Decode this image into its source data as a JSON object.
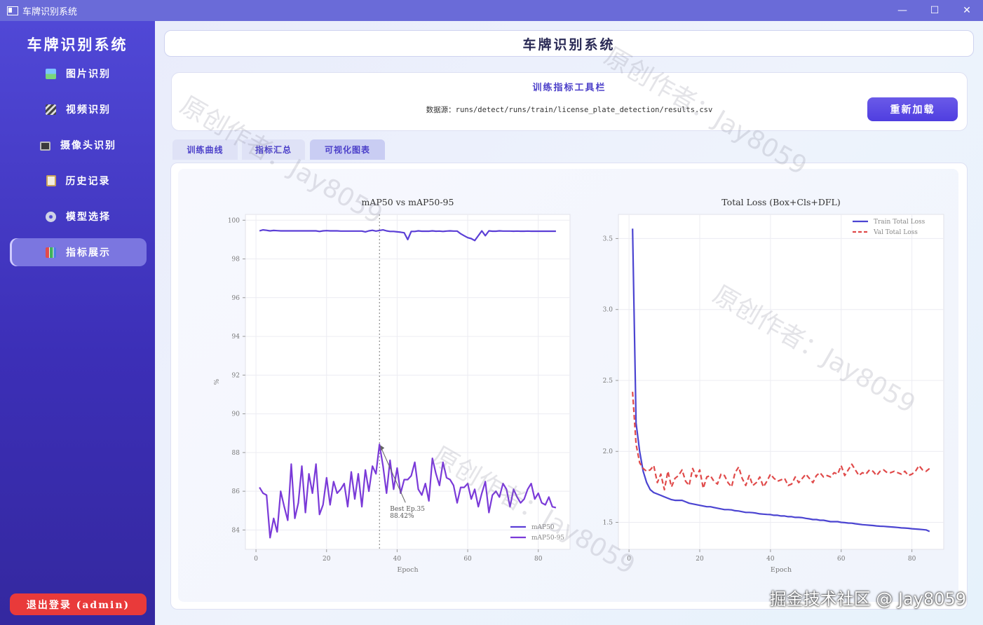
{
  "window": {
    "title": "车牌识别系统",
    "minimize": "—",
    "maximize": "☐",
    "close": "✕"
  },
  "sidebar": {
    "brand": "车牌识别系统",
    "items": [
      {
        "label": "图片识别",
        "icon": "picture-icon"
      },
      {
        "label": "视频识别",
        "icon": "clapper-icon"
      },
      {
        "label": "摄像头识别",
        "icon": "camera-icon"
      },
      {
        "label": "历史记录",
        "icon": "clipboard-icon"
      },
      {
        "label": "模型选择",
        "icon": "gear-icon"
      },
      {
        "label": "指标展示",
        "icon": "bar-chart-icon",
        "active": true
      }
    ],
    "logout": "退出登录 (admin)"
  },
  "header": {
    "title": "车牌识别系统"
  },
  "toolbar": {
    "title": "训练指标工具栏",
    "source_label": "数据源：",
    "source_path": "runs/detect/runs/train/license_plate_detection/results.csv",
    "reload": "重新加载"
  },
  "tabs": [
    {
      "label": "训练曲线"
    },
    {
      "label": "指标汇总"
    },
    {
      "label": "可视化图表",
      "active": true
    }
  ],
  "watermarks": {
    "author": "原创作者：Jay8059",
    "footer": "掘金技术社区 @ Jay8059"
  },
  "colors": {
    "accent": "#4f3ee0",
    "map50": "#5b3fd6",
    "map5095": "#7a3ad8",
    "train_loss": "#4b44d1",
    "val_loss": "#e04a4a",
    "logout": "#e93a3a"
  },
  "chart_data": [
    {
      "type": "line",
      "title": "mAP50 vs mAP50-95",
      "xlabel": "Epoch",
      "ylabel": "%",
      "xlim": [
        -3,
        89
      ],
      "ylim": [
        83,
        100.3
      ],
      "xticks": [
        0,
        20,
        40,
        60,
        80
      ],
      "yticks": [
        84,
        86,
        88,
        90,
        92,
        94,
        96,
        98,
        100
      ],
      "legend": "bottom-right",
      "grid": true,
      "annotation": {
        "x": 35,
        "y": 88.42,
        "text_line1": "Best Ep.35",
        "text_line2": "88.42%"
      },
      "best_epoch_line": 35,
      "series": [
        {
          "name": "mAP50",
          "x": [
            1,
            2,
            3,
            4,
            5,
            6,
            7,
            8,
            9,
            10,
            11,
            12,
            13,
            14,
            15,
            16,
            17,
            18,
            19,
            20,
            21,
            22,
            23,
            24,
            25,
            26,
            27,
            28,
            29,
            30,
            31,
            32,
            33,
            34,
            35,
            36,
            37,
            38,
            39,
            40,
            41,
            42,
            43,
            44,
            45,
            46,
            47,
            48,
            49,
            50,
            51,
            52,
            53,
            54,
            55,
            56,
            57,
            58,
            59,
            60,
            61,
            62,
            63,
            64,
            65,
            66,
            67,
            68,
            69,
            70,
            71,
            72,
            73,
            74,
            75,
            76,
            77,
            78,
            79,
            80,
            81,
            82,
            83,
            84,
            85
          ],
          "y": [
            99.45,
            99.5,
            99.48,
            99.45,
            99.47,
            99.46,
            99.45,
            99.45,
            99.45,
            99.45,
            99.45,
            99.45,
            99.45,
            99.45,
            99.45,
            99.45,
            99.45,
            99.42,
            99.45,
            99.46,
            99.45,
            99.45,
            99.45,
            99.44,
            99.44,
            99.44,
            99.44,
            99.44,
            99.44,
            99.44,
            99.4,
            99.45,
            99.48,
            99.44,
            99.47,
            99.5,
            99.45,
            99.42,
            99.42,
            99.4,
            99.38,
            99.35,
            99.0,
            99.42,
            99.42,
            99.45,
            99.43,
            99.43,
            99.43,
            99.45,
            99.43,
            99.44,
            99.42,
            99.44,
            99.45,
            99.44,
            99.44,
            99.3,
            99.2,
            99.1,
            99.05,
            98.95,
            99.2,
            99.45,
            99.2,
            99.45,
            99.43,
            99.43,
            99.45,
            99.44,
            99.44,
            99.44,
            99.43,
            99.44,
            99.43,
            99.43,
            99.44,
            99.43,
            99.43,
            99.43,
            99.43,
            99.43,
            99.43,
            99.43,
            99.43
          ]
        },
        {
          "name": "mAP50-95",
          "x": [
            1,
            2,
            3,
            4,
            5,
            6,
            7,
            8,
            9,
            10,
            11,
            12,
            13,
            14,
            15,
            16,
            17,
            18,
            19,
            20,
            21,
            22,
            23,
            24,
            25,
            26,
            27,
            28,
            29,
            30,
            31,
            32,
            33,
            34,
            35,
            36,
            37,
            38,
            39,
            40,
            41,
            42,
            43,
            44,
            45,
            46,
            47,
            48,
            49,
            50,
            51,
            52,
            53,
            54,
            55,
            56,
            57,
            58,
            59,
            60,
            61,
            62,
            63,
            64,
            65,
            66,
            67,
            68,
            69,
            70,
            71,
            72,
            73,
            74,
            75,
            76,
            77,
            78,
            79,
            80,
            81,
            82,
            83,
            84,
            85
          ],
          "y": [
            86.2,
            85.9,
            85.8,
            83.6,
            84.6,
            83.9,
            86.0,
            85.2,
            84.5,
            87.4,
            84.6,
            85.4,
            87.3,
            84.9,
            86.9,
            85.9,
            87.4,
            84.8,
            85.3,
            86.7,
            85.3,
            86.5,
            85.9,
            86.1,
            86.4,
            85.2,
            87.0,
            85.6,
            86.9,
            85.2,
            87.1,
            86.0,
            87.3,
            86.9,
            88.42,
            87.3,
            85.9,
            87.6,
            86.1,
            87.2,
            85.9,
            86.6,
            86.6,
            86.8,
            87.5,
            86.1,
            85.8,
            86.4,
            85.5,
            87.7,
            86.9,
            86.3,
            87.5,
            86.7,
            86.6,
            86.3,
            85.4,
            86.2,
            86.2,
            86.4,
            85.6,
            86.1,
            85.2,
            85.9,
            86.5,
            84.9,
            85.8,
            86.0,
            85.7,
            86.4,
            86.1,
            85.2,
            86.1,
            85.7,
            85.4,
            85.6,
            86.1,
            86.4,
            85.6,
            85.9,
            85.4,
            85.3,
            85.7,
            85.2,
            85.15
          ]
        }
      ]
    },
    {
      "type": "line",
      "title": "Total Loss (Box+Cls+DFL)",
      "xlabel": "Epoch",
      "ylabel": "",
      "xlim": [
        -3,
        89
      ],
      "ylim": [
        1.31,
        3.67
      ],
      "xticks": [
        0,
        20,
        40,
        60,
        80
      ],
      "yticks": [
        1.5,
        2.0,
        2.5,
        3.0,
        3.5
      ],
      "legend": "top-right",
      "grid": true,
      "series": [
        {
          "name": "Train Total Loss",
          "x": [
            1,
            2,
            3,
            4,
            5,
            6,
            7,
            8,
            9,
            10,
            11,
            12,
            13,
            14,
            15,
            16,
            17,
            18,
            19,
            20,
            21,
            22,
            23,
            24,
            25,
            26,
            27,
            28,
            29,
            30,
            31,
            32,
            33,
            34,
            35,
            36,
            37,
            38,
            39,
            40,
            41,
            42,
            43,
            44,
            45,
            46,
            47,
            48,
            49,
            50,
            51,
            52,
            53,
            54,
            55,
            56,
            57,
            58,
            59,
            60,
            61,
            62,
            63,
            64,
            65,
            66,
            67,
            68,
            69,
            70,
            71,
            72,
            73,
            74,
            75,
            76,
            77,
            78,
            79,
            80,
            81,
            82,
            83,
            84,
            85
          ],
          "y": [
            3.57,
            2.2,
            2.0,
            1.86,
            1.78,
            1.73,
            1.71,
            1.7,
            1.69,
            1.68,
            1.67,
            1.66,
            1.655,
            1.655,
            1.655,
            1.645,
            1.635,
            1.63,
            1.625,
            1.62,
            1.615,
            1.61,
            1.61,
            1.605,
            1.6,
            1.595,
            1.59,
            1.59,
            1.588,
            1.582,
            1.58,
            1.575,
            1.57,
            1.57,
            1.568,
            1.565,
            1.56,
            1.558,
            1.556,
            1.555,
            1.55,
            1.55,
            1.545,
            1.545,
            1.54,
            1.54,
            1.535,
            1.535,
            1.533,
            1.528,
            1.525,
            1.52,
            1.52,
            1.515,
            1.515,
            1.51,
            1.505,
            1.505,
            1.505,
            1.5,
            1.498,
            1.495,
            1.494,
            1.49,
            1.487,
            1.484,
            1.482,
            1.48,
            1.478,
            1.475,
            1.473,
            1.472,
            1.47,
            1.468,
            1.466,
            1.464,
            1.461,
            1.46,
            1.458,
            1.455,
            1.453,
            1.451,
            1.449,
            1.447,
            1.436
          ]
        },
        {
          "name": "Val Total Loss",
          "x": [
            1,
            2,
            3,
            4,
            5,
            6,
            7,
            8,
            9,
            10,
            11,
            12,
            13,
            14,
            15,
            16,
            17,
            18,
            19,
            20,
            21,
            22,
            23,
            24,
            25,
            26,
            27,
            28,
            29,
            30,
            31,
            32,
            33,
            34,
            35,
            36,
            37,
            38,
            39,
            40,
            41,
            42,
            43,
            44,
            45,
            46,
            47,
            48,
            49,
            50,
            51,
            52,
            53,
            54,
            55,
            56,
            57,
            58,
            59,
            60,
            61,
            62,
            63,
            64,
            65,
            66,
            67,
            68,
            69,
            70,
            71,
            72,
            73,
            74,
            75,
            76,
            77,
            78,
            79,
            80,
            81,
            82,
            83,
            84,
            85
          ],
          "y": [
            2.42,
            2.05,
            1.92,
            1.88,
            1.86,
            1.87,
            1.9,
            1.78,
            1.84,
            1.73,
            1.86,
            1.75,
            1.81,
            1.83,
            1.87,
            1.79,
            1.76,
            1.88,
            1.82,
            1.87,
            1.74,
            1.82,
            1.83,
            1.79,
            1.77,
            1.84,
            1.83,
            1.78,
            1.75,
            1.85,
            1.89,
            1.81,
            1.76,
            1.83,
            1.76,
            1.78,
            1.82,
            1.75,
            1.79,
            1.84,
            1.81,
            1.79,
            1.8,
            1.81,
            1.76,
            1.77,
            1.82,
            1.78,
            1.81,
            1.84,
            1.81,
            1.78,
            1.83,
            1.85,
            1.82,
            1.83,
            1.82,
            1.85,
            1.84,
            1.9,
            1.83,
            1.87,
            1.91,
            1.87,
            1.83,
            1.85,
            1.84,
            1.87,
            1.86,
            1.83,
            1.86,
            1.87,
            1.85,
            1.85,
            1.86,
            1.85,
            1.84,
            1.86,
            1.83,
            1.84,
            1.86,
            1.9,
            1.87,
            1.86,
            1.88
          ]
        }
      ]
    }
  ]
}
